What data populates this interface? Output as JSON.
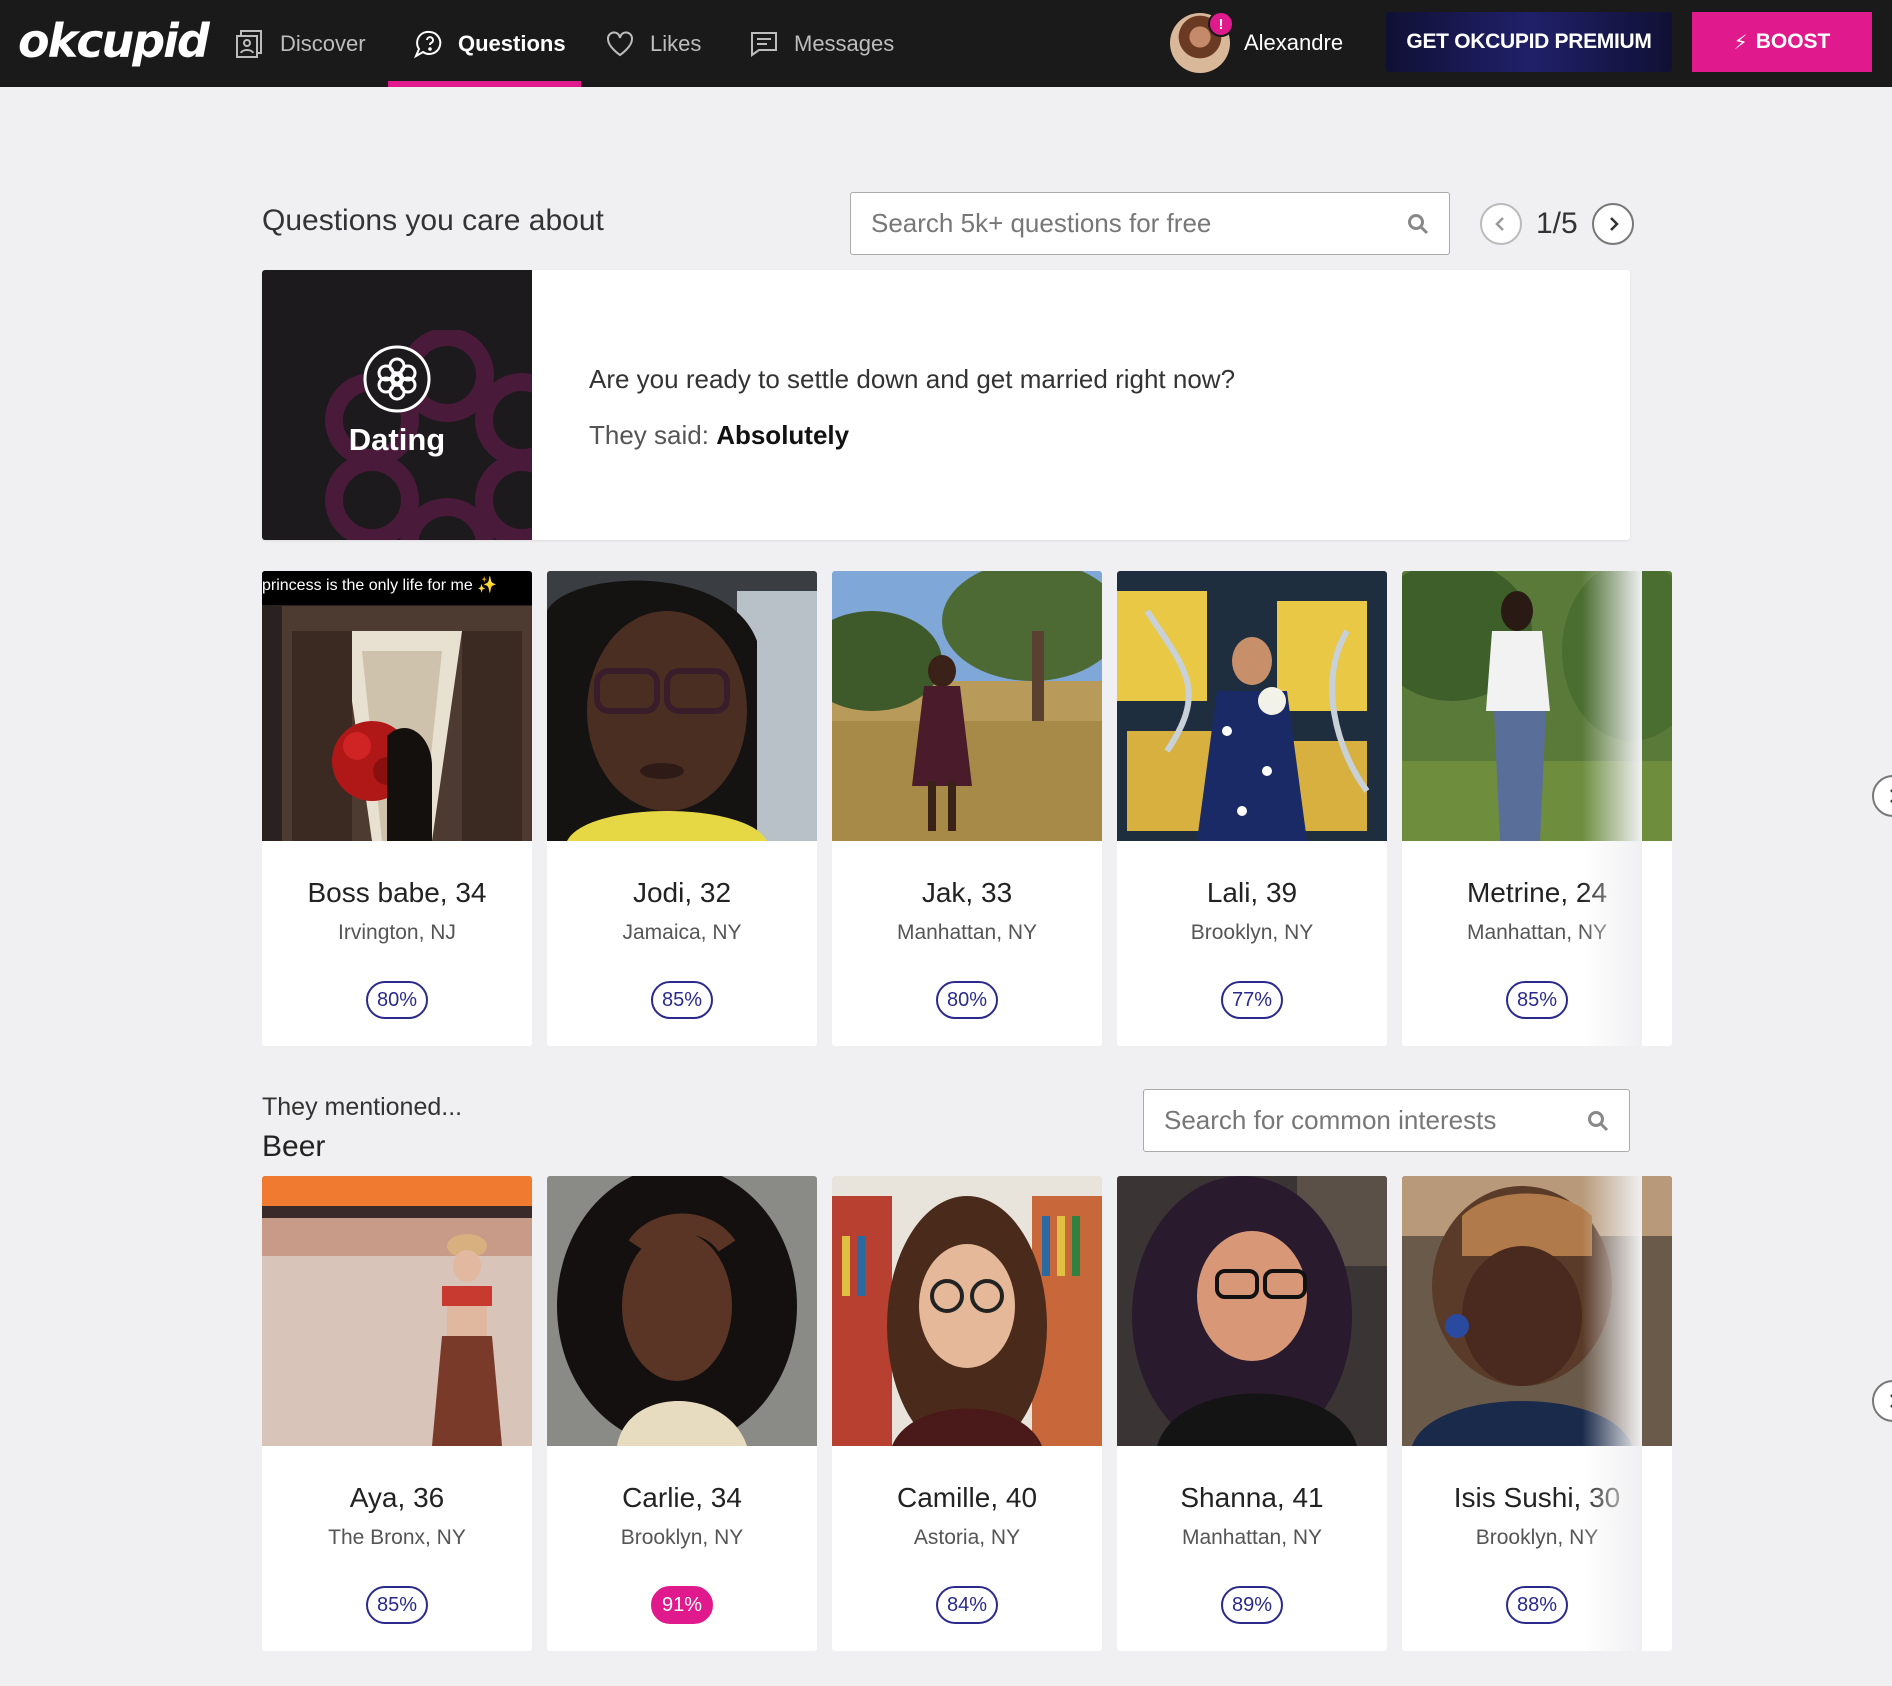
{
  "nav": {
    "logo": "okcupid",
    "items": [
      {
        "label": "Discover",
        "icon": "discover-icon"
      },
      {
        "label": "Questions",
        "icon": "question-bubble-icon",
        "active": true
      },
      {
        "label": "Likes",
        "icon": "heart-icon"
      },
      {
        "label": "Messages",
        "icon": "chat-icon"
      }
    ],
    "user_name": "Alexandre",
    "user_badge": "!",
    "premium_label": "GET OKCUPID PREMIUM",
    "boost_label": "BOOST"
  },
  "questions": {
    "title": "Questions you care about",
    "search_placeholder": "Search 5k+ questions for free",
    "pager": "1/5",
    "category": "Dating",
    "question": "Are you ready to settle down and get married right now?",
    "answer_prefix": "They said:",
    "answer": "Absolutely"
  },
  "question_matches": [
    {
      "name": "Boss babe, 34",
      "location": "Irvington, NJ",
      "match": "80%",
      "caption": "princess is the only life for me ✨"
    },
    {
      "name": "Jodi, 32",
      "location": "Jamaica, NY",
      "match": "85%"
    },
    {
      "name": "Jak, 33",
      "location": "Manhattan, NY",
      "match": "80%"
    },
    {
      "name": "Lali, 39",
      "location": "Brooklyn, NY",
      "match": "77%"
    },
    {
      "name": "Metrine, 24",
      "location": "Manhattan, NY",
      "match": "85%"
    }
  ],
  "interests": {
    "intro": "They mentioned...",
    "topic": "Beer",
    "search_placeholder": "Search for common interests"
  },
  "interest_matches": [
    {
      "name": "Aya, 36",
      "location": "The Bronx, NY",
      "match": "85%"
    },
    {
      "name": "Carlie, 34",
      "location": "Brooklyn, NY",
      "match": "91%",
      "highlight": true
    },
    {
      "name": "Camille, 40",
      "location": "Astoria, NY",
      "match": "84%"
    },
    {
      "name": "Shanna, 41",
      "location": "Manhattan, NY",
      "match": "89%"
    },
    {
      "name": "Isis Sushi, 30",
      "location": "Brooklyn, NY",
      "match": "88%"
    }
  ],
  "colors": {
    "accent": "#e01a8c",
    "nav_bg": "#1a1a1a",
    "match_pill": "#2a2a8c",
    "premium_bg": "#1a1a50"
  }
}
